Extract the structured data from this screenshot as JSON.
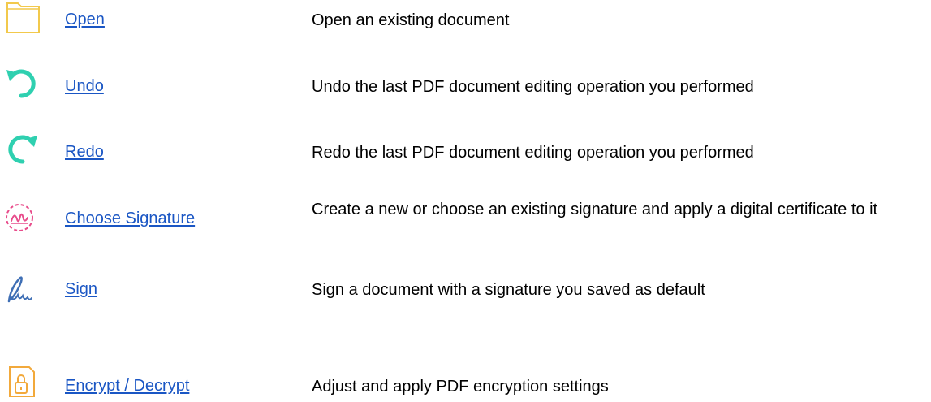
{
  "colors": {
    "link": "#1a56c4",
    "text": "#000000",
    "folder_icon": "#f2c94c",
    "undo_redo_icon": "#2fd0b0",
    "signature_icon": "#e84c8b",
    "sign_icon": "#3f6fb5",
    "lock_icon": "#f2a93b"
  },
  "commands": [
    {
      "icon": "folder-icon",
      "label": "Open",
      "description": "Open an existing document"
    },
    {
      "icon": "undo-icon",
      "label": "Undo",
      "description": "Undo the last PDF document editing operation you performed"
    },
    {
      "icon": "redo-icon",
      "label": "Redo",
      "description": "Redo the last PDF document editing operation you performed"
    },
    {
      "icon": "signature-stamp-icon",
      "label": "Choose Signature",
      "description": "Create a new or choose an existing signature and apply a digital certificate to it"
    },
    {
      "icon": "pen-signature-icon",
      "label": "Sign",
      "description": "Sign a document with a signature you saved as default"
    },
    {
      "icon": "lock-file-icon",
      "label": "Encrypt / Decrypt",
      "description": "Adjust and apply PDF encryption settings"
    }
  ]
}
